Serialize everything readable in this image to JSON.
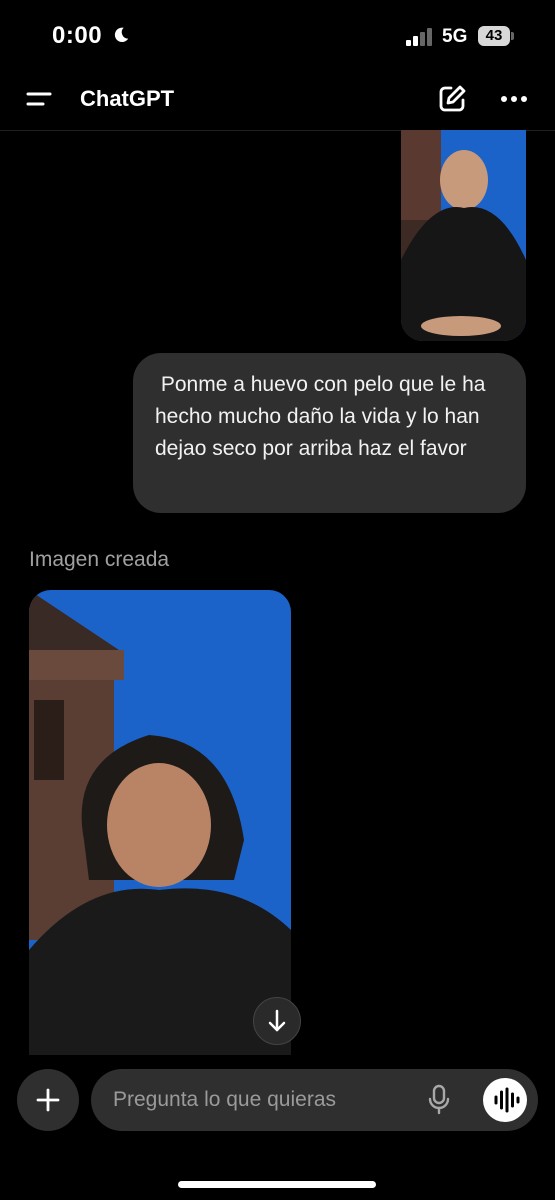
{
  "status_bar": {
    "time": "0:00",
    "network": "5G",
    "battery": "43",
    "icons": [
      "moon-icon",
      "signal-icon",
      "battery-icon"
    ]
  },
  "header": {
    "title": "ChatGPT",
    "icons": [
      "menu-icon",
      "edit-icon",
      "more-icon"
    ]
  },
  "chat": {
    "user_message": " Ponme a huevo con pelo que le ha hecho mucho daño la vida y lo han dejao seco por arriba haz el favor",
    "image_label": "Imagen creada"
  },
  "composer": {
    "placeholder": "Pregunta lo que quieras",
    "value": "",
    "icons": [
      "plus-icon",
      "mic-icon",
      "voice-mode-icon"
    ]
  },
  "colors": {
    "background": "#000000",
    "bubble": "#2f2f2f",
    "sky": "#1c63c9",
    "label_gray": "#a0a0a0"
  }
}
